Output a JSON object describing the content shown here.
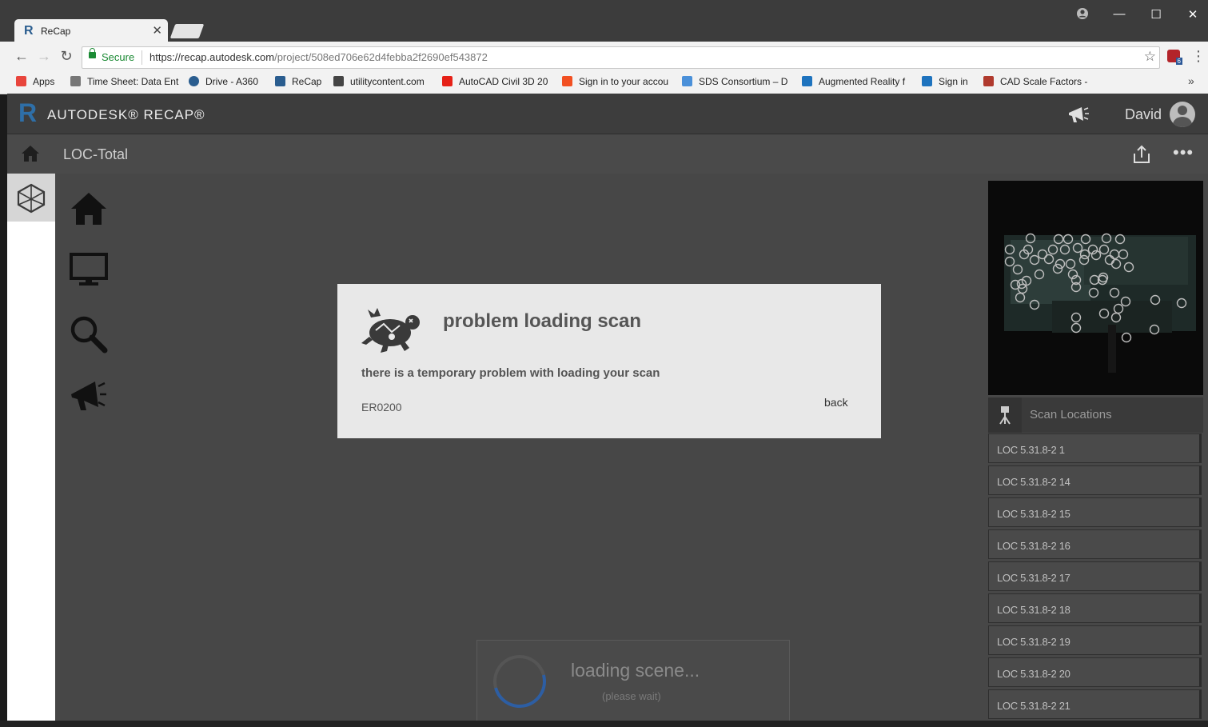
{
  "browser": {
    "tab_title": "ReCap",
    "secure_label": "Secure",
    "url_host": "https://recap.autodesk.com",
    "url_path": "/project/508ed706e62d4febba2f2690ef543872",
    "extension_badge": "6",
    "bookmarks": [
      {
        "label": "Apps",
        "icon": "apps-grid-icon",
        "color": "#e8453c"
      },
      {
        "label": "Time Sheet: Data Ent",
        "icon": "page-icon",
        "color": "#777777"
      },
      {
        "label": "Drive - A360",
        "icon": "a360-icon",
        "color": "#2a5d8f"
      },
      {
        "label": "ReCap",
        "icon": "recap-icon",
        "color": "#2a5d8f"
      },
      {
        "label": "utilitycontent.com",
        "icon": "site-icon",
        "color": "#444444"
      },
      {
        "label": "AutoCAD Civil 3D 20",
        "icon": "youtube-icon",
        "color": "#e62117"
      },
      {
        "label": "Sign in to your accou",
        "icon": "microsoft-icon",
        "color": "#f25022"
      },
      {
        "label": "SDS Consortium – D",
        "icon": "sds-icon",
        "color": "#4a90d9"
      },
      {
        "label": "Augmented Reality f",
        "icon": "autodesk-icon",
        "color": "#1e73be"
      },
      {
        "label": "Sign in",
        "icon": "autodesk-icon",
        "color": "#1e73be"
      },
      {
        "label": "CAD Scale Factors -",
        "icon": "at-icon",
        "color": "#b03a2e"
      }
    ]
  },
  "app": {
    "logo_letter": "R",
    "brand": "AUTODESK® RECAP®",
    "user_name": "David",
    "project_title": "LOC-Total"
  },
  "dialog": {
    "title": "problem loading scan",
    "message": "there is a temporary problem with loading your scan",
    "code": "ER0200",
    "back_label": "back"
  },
  "loading": {
    "title": "loading scene...",
    "subtitle": "(please wait)"
  },
  "scan_panel": {
    "title": "Scan Locations",
    "items": [
      "LOC 5.31.8-2 1",
      "LOC 5.31.8-2 14",
      "LOC 5.31.8-2 15",
      "LOC 5.31.8-2 16",
      "LOC 5.31.8-2 17",
      "LOC 5.31.8-2 18",
      "LOC 5.31.8-2 19",
      "LOC 5.31.8-2 20",
      "LOC 5.31.8-2 21"
    ]
  }
}
